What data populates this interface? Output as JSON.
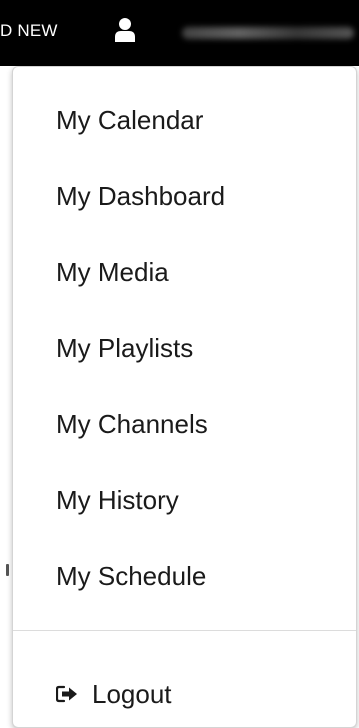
{
  "topbar": {
    "partial_label": "D NEW",
    "user_icon": "user-icon"
  },
  "menu": {
    "items": [
      {
        "label": "My Calendar"
      },
      {
        "label": "My Dashboard"
      },
      {
        "label": "My Media"
      },
      {
        "label": "My Playlists"
      },
      {
        "label": "My Channels"
      },
      {
        "label": "My History"
      },
      {
        "label": "My Schedule"
      }
    ],
    "logout": {
      "label": "Logout",
      "icon": "logout-icon"
    }
  },
  "colors": {
    "topbar_bg": "#000000",
    "menu_bg": "#ffffff",
    "text": "#1a1a1a"
  }
}
